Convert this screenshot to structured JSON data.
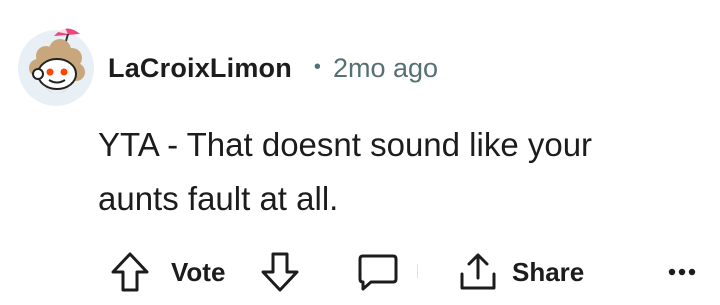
{
  "comment": {
    "username": "LaCroixLimon",
    "separator": "•",
    "timestamp": "2mo ago",
    "body_lines": [
      "YTA - That doesnt sound like your",
      "aunts fault at all."
    ]
  },
  "actions": {
    "upvote_icon": "arrow-up-icon",
    "vote_label": "Vote",
    "downvote_icon": "arrow-down-icon",
    "comment_icon": "speech-bubble-icon",
    "share_icon": "share-icon",
    "share_label": "Share",
    "more_icon": "ellipsis-icon"
  },
  "colors": {
    "text": "#1c1c1c",
    "meta": "#576f76",
    "avatar_bg": "#e9f0f5"
  }
}
